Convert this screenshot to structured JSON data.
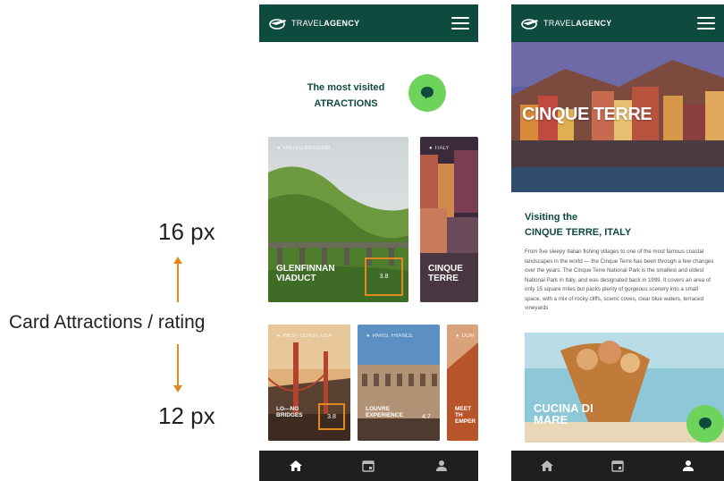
{
  "annotations": {
    "top_spacing": "16 px",
    "bottom_spacing": "12 px",
    "label": "Card Attractions / rating"
  },
  "brand": {
    "logo_light": "TRAVEL",
    "logo_bold": "AGENCY"
  },
  "screen1": {
    "section_title_line1": "The most visited",
    "section_title_line2": "ATRACTIONS",
    "large_cards": [
      {
        "location": "UNITED KINGDOM",
        "title_line1": "GLENFINNAN",
        "title_line2": "VIADUCT",
        "rating": "3.8"
      },
      {
        "location": "ITALY",
        "title_line1": "CINQUE",
        "title_line2": "TERRE",
        "rating": ""
      }
    ],
    "small_cards": [
      {
        "location": "WEST COAST, USA",
        "title_line1": "LO—NG",
        "title_line2": "BRIDGES",
        "rating": "3.8"
      },
      {
        "location": "PARIS, FRANCE",
        "title_line1": "LOUVRE",
        "title_line2": "EXPERIENCE",
        "rating": "4.7"
      },
      {
        "location": "DOM",
        "title_line1": "MEET TH",
        "title_line2": "EMPER",
        "rating": ""
      }
    ]
  },
  "screen2": {
    "hero_title": "CINQUE TERRE",
    "visit_line1": "Visiting the",
    "visit_line2": "CINQUE TERRE, ITALY",
    "description": "From five sleepy Italian fishing villages to one of the most famous coastal landscapes in the world — the Cinque Terre has been through a few changes over the years. The Cinque Terre National Park is the smallest and oldest National Park in Italy, and was designated back in 1999. It covers an area of only 15 square miles but packs plenty of gorgeous scenery into a small space, with a mix of rocky cliffs, scenic coves, clear blue waters, terraced vineyards",
    "food_title_line1": "CUCINA DI",
    "food_title_line2": "MARE"
  },
  "nav_icons": [
    "home-icon",
    "calendar-icon",
    "user-icon"
  ],
  "colors": {
    "primary": "#0f4a3f",
    "accent_green": "#6dd35b",
    "highlight_orange": "#e08a1e",
    "bottom_bar": "#1f1f1f"
  }
}
